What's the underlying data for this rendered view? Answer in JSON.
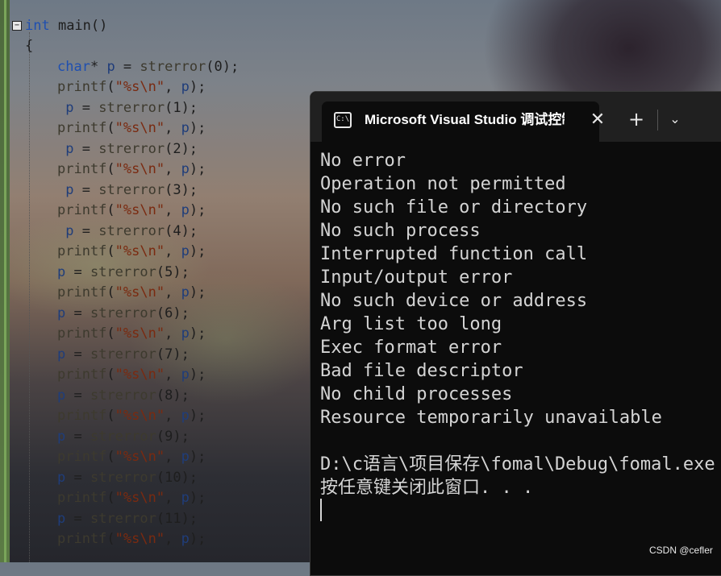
{
  "editor": {
    "lines": [
      {
        "parts": [
          [
            "kw",
            "int"
          ],
          [
            "pun",
            " main()"
          ]
        ]
      },
      {
        "parts": [
          [
            "pun",
            "{"
          ]
        ]
      },
      {
        "parts": [
          [
            "kw",
            "char"
          ],
          [
            "pun",
            "* "
          ],
          [
            "var",
            "p"
          ],
          [
            "pun",
            " = "
          ],
          [
            "fn",
            "strerror"
          ],
          [
            "pun",
            "(0);"
          ]
        ]
      },
      {
        "parts": [
          [
            "fn",
            "printf"
          ],
          [
            "pun",
            "("
          ],
          [
            "str",
            "\"%s\\n\""
          ],
          [
            "pun",
            ", "
          ],
          [
            "var",
            "p"
          ],
          [
            "pun",
            ");"
          ]
        ]
      },
      {
        "parts": [
          [
            "var",
            " p"
          ],
          [
            "pun",
            " = "
          ],
          [
            "fn",
            "strerror"
          ],
          [
            "pun",
            "(1);"
          ]
        ]
      },
      {
        "parts": [
          [
            "fn",
            "printf"
          ],
          [
            "pun",
            "("
          ],
          [
            "str",
            "\"%s\\n\""
          ],
          [
            "pun",
            ", "
          ],
          [
            "var",
            "p"
          ],
          [
            "pun",
            ");"
          ]
        ]
      },
      {
        "parts": [
          [
            "var",
            " p"
          ],
          [
            "pun",
            " = "
          ],
          [
            "fn",
            "strerror"
          ],
          [
            "pun",
            "(2);"
          ]
        ]
      },
      {
        "parts": [
          [
            "fn",
            "printf"
          ],
          [
            "pun",
            "("
          ],
          [
            "str",
            "\"%s\\n\""
          ],
          [
            "pun",
            ", "
          ],
          [
            "var",
            "p"
          ],
          [
            "pun",
            ");"
          ]
        ]
      },
      {
        "parts": [
          [
            "var",
            " p"
          ],
          [
            "pun",
            " = "
          ],
          [
            "fn",
            "strerror"
          ],
          [
            "pun",
            "(3);"
          ]
        ]
      },
      {
        "parts": [
          [
            "fn",
            "printf"
          ],
          [
            "pun",
            "("
          ],
          [
            "str",
            "\"%s\\n\""
          ],
          [
            "pun",
            ", "
          ],
          [
            "var",
            "p"
          ],
          [
            "pun",
            ");"
          ]
        ]
      },
      {
        "parts": [
          [
            "var",
            " p"
          ],
          [
            "pun",
            " = "
          ],
          [
            "fn",
            "strerror"
          ],
          [
            "pun",
            "(4);"
          ]
        ]
      },
      {
        "parts": [
          [
            "fn",
            "printf"
          ],
          [
            "pun",
            "("
          ],
          [
            "str",
            "\"%s\\n\""
          ],
          [
            "pun",
            ", "
          ],
          [
            "var",
            "p"
          ],
          [
            "pun",
            ");"
          ]
        ]
      },
      {
        "parts": [
          [
            "var",
            "p"
          ],
          [
            "pun",
            " = "
          ],
          [
            "fn",
            "strerror"
          ],
          [
            "pun",
            "(5);"
          ]
        ]
      },
      {
        "parts": [
          [
            "fn",
            "printf"
          ],
          [
            "pun",
            "("
          ],
          [
            "str",
            "\"%s\\n\""
          ],
          [
            "pun",
            ", "
          ],
          [
            "var",
            "p"
          ],
          [
            "pun",
            ");"
          ]
        ]
      },
      {
        "parts": [
          [
            "var",
            "p"
          ],
          [
            "pun",
            " = "
          ],
          [
            "fn",
            "strerror"
          ],
          [
            "pun",
            "(6);"
          ]
        ]
      },
      {
        "parts": [
          [
            "fn",
            "printf"
          ],
          [
            "pun",
            "("
          ],
          [
            "str",
            "\"%s\\n\""
          ],
          [
            "pun",
            ", "
          ],
          [
            "var",
            "p"
          ],
          [
            "pun",
            ");"
          ]
        ]
      },
      {
        "parts": [
          [
            "var",
            "p"
          ],
          [
            "pun",
            " = "
          ],
          [
            "fn",
            "strerror"
          ],
          [
            "pun",
            "(7);"
          ]
        ]
      },
      {
        "parts": [
          [
            "fn",
            "printf"
          ],
          [
            "pun",
            "("
          ],
          [
            "str",
            "\"%s\\n\""
          ],
          [
            "pun",
            ", "
          ],
          [
            "var",
            "p"
          ],
          [
            "pun",
            ");"
          ]
        ]
      },
      {
        "parts": [
          [
            "var",
            "p"
          ],
          [
            "pun",
            " = "
          ],
          [
            "fn",
            "strerror"
          ],
          [
            "pun",
            "(8);"
          ]
        ]
      },
      {
        "parts": [
          [
            "fn",
            "printf"
          ],
          [
            "pun",
            "("
          ],
          [
            "str",
            "\"%s\\n\""
          ],
          [
            "pun",
            ", "
          ],
          [
            "var",
            "p"
          ],
          [
            "pun",
            ");"
          ]
        ]
      },
      {
        "parts": [
          [
            "var",
            "p"
          ],
          [
            "pun",
            " = "
          ],
          [
            "fn",
            "strerror"
          ],
          [
            "pun",
            "(9);"
          ]
        ]
      },
      {
        "parts": [
          [
            "fn",
            "printf"
          ],
          [
            "pun",
            "("
          ],
          [
            "str",
            "\"%s\\n\""
          ],
          [
            "pun",
            ", "
          ],
          [
            "var",
            "p"
          ],
          [
            "pun",
            ");"
          ]
        ]
      },
      {
        "parts": [
          [
            "var",
            "p"
          ],
          [
            "pun",
            " = "
          ],
          [
            "fn",
            "strerror"
          ],
          [
            "pun",
            "(10);"
          ]
        ]
      },
      {
        "parts": [
          [
            "fn",
            "printf"
          ],
          [
            "pun",
            "("
          ],
          [
            "str",
            "\"%s\\n\""
          ],
          [
            "pun",
            ", "
          ],
          [
            "var",
            "p"
          ],
          [
            "pun",
            ");"
          ]
        ]
      },
      {
        "parts": [
          [
            "var",
            "p"
          ],
          [
            "pun",
            " = "
          ],
          [
            "fn",
            "strerror"
          ],
          [
            "pun",
            "(11);"
          ]
        ]
      },
      {
        "parts": [
          [
            "fn",
            "printf"
          ],
          [
            "pun",
            "("
          ],
          [
            "str",
            "\"%s\\n\""
          ],
          [
            "pun",
            ", "
          ],
          [
            "var",
            "p"
          ],
          [
            "pun",
            ");"
          ]
        ]
      }
    ],
    "fold_glyph": "−"
  },
  "terminal": {
    "tab_icon": "terminal-icon",
    "tab_icon_text": "C:\\",
    "tab_title": "Microsoft Visual Studio 调试控制台",
    "close_glyph": "✕",
    "new_tab_glyph": "+",
    "dropdown_glyph": "⌄",
    "output": [
      "No error",
      "Operation not permitted",
      "No such file or directory",
      "No such process",
      "Interrupted function call",
      "Input/output error",
      "No such device or address",
      "Arg list too long",
      "Exec format error",
      "Bad file descriptor",
      "No child processes",
      "Resource temporarily unavailable",
      "",
      "D:\\c语言\\项目保存\\fomal\\Debug\\fomal.exe",
      "按任意键关闭此窗口. . ."
    ]
  },
  "watermark": "CSDN @cefler"
}
